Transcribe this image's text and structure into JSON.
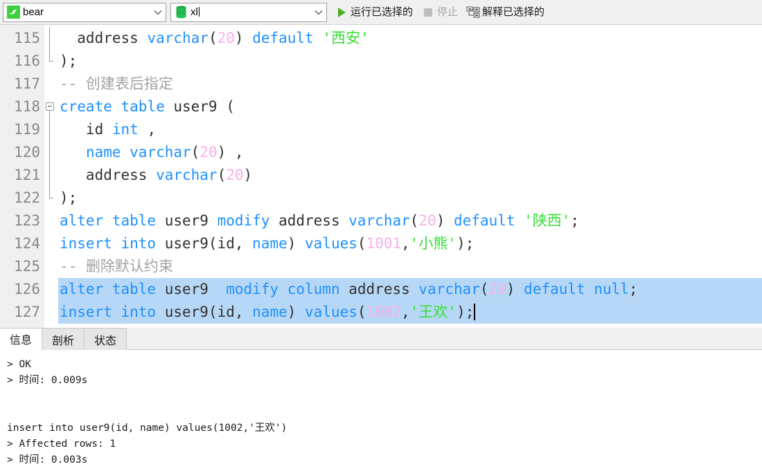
{
  "toolbar": {
    "connection": {
      "icon": "mysql-dolphin-icon",
      "value": "bear",
      "caret": "∨"
    },
    "database": {
      "icon": "database-icon",
      "value": "xl",
      "caret": "∨"
    },
    "run_selected": {
      "icon": "play-icon",
      "label": "运行已选择的"
    },
    "stop": {
      "icon": "stop-icon",
      "label": "停止",
      "disabled": true
    },
    "explain_selected": {
      "icon": "explain-plan-icon",
      "label": "解释已选择的"
    }
  },
  "editor": {
    "first_line_number": 115,
    "lines": [
      {
        "num": 115,
        "selected": false,
        "fold": "mid",
        "tokens": [
          {
            "t": "  address ",
            "c": "plain"
          },
          {
            "t": "varchar",
            "c": "kw"
          },
          {
            "t": "(",
            "c": "plain"
          },
          {
            "t": "20",
            "c": "num"
          },
          {
            "t": ") ",
            "c": "plain"
          },
          {
            "t": "default",
            "c": "kw"
          },
          {
            "t": " ",
            "c": "plain"
          },
          {
            "t": "'西安'",
            "c": "str"
          }
        ]
      },
      {
        "num": 116,
        "selected": false,
        "fold": "end",
        "tokens": [
          {
            "t": ");",
            "c": "plain"
          }
        ]
      },
      {
        "num": 117,
        "selected": false,
        "fold": "none",
        "tokens": [
          {
            "t": "-- 创建表后指定",
            "c": "cmt"
          }
        ]
      },
      {
        "num": 118,
        "selected": false,
        "fold": "start",
        "tokens": [
          {
            "t": "create table",
            "c": "kw"
          },
          {
            "t": " user9 (",
            "c": "plain"
          }
        ]
      },
      {
        "num": 119,
        "selected": false,
        "fold": "mid",
        "tokens": [
          {
            "t": "   id ",
            "c": "plain"
          },
          {
            "t": "int",
            "c": "kw"
          },
          {
            "t": " ,",
            "c": "plain"
          }
        ]
      },
      {
        "num": 120,
        "selected": false,
        "fold": "mid",
        "tokens": [
          {
            "t": "   ",
            "c": "plain"
          },
          {
            "t": "name varchar",
            "c": "kw"
          },
          {
            "t": "(",
            "c": "plain"
          },
          {
            "t": "20",
            "c": "num"
          },
          {
            "t": ") ,",
            "c": "plain"
          }
        ]
      },
      {
        "num": 121,
        "selected": false,
        "fold": "mid",
        "tokens": [
          {
            "t": "   address ",
            "c": "plain"
          },
          {
            "t": "varchar",
            "c": "kw"
          },
          {
            "t": "(",
            "c": "plain"
          },
          {
            "t": "20",
            "c": "num"
          },
          {
            "t": ")",
            "c": "plain"
          }
        ]
      },
      {
        "num": 122,
        "selected": false,
        "fold": "end",
        "tokens": [
          {
            "t": ");",
            "c": "plain"
          }
        ]
      },
      {
        "num": 123,
        "selected": false,
        "fold": "none",
        "tokens": [
          {
            "t": "alter table",
            "c": "kw"
          },
          {
            "t": " user9 ",
            "c": "plain"
          },
          {
            "t": "modify",
            "c": "kw"
          },
          {
            "t": " address ",
            "c": "plain"
          },
          {
            "t": "varchar",
            "c": "kw"
          },
          {
            "t": "(",
            "c": "plain"
          },
          {
            "t": "20",
            "c": "num"
          },
          {
            "t": ") ",
            "c": "plain"
          },
          {
            "t": "default",
            "c": "kw"
          },
          {
            "t": " ",
            "c": "plain"
          },
          {
            "t": "'陕西'",
            "c": "str"
          },
          {
            "t": ";",
            "c": "plain"
          }
        ]
      },
      {
        "num": 124,
        "selected": false,
        "fold": "none",
        "tokens": [
          {
            "t": "insert into",
            "c": "kw"
          },
          {
            "t": " user9(id, ",
            "c": "plain"
          },
          {
            "t": "name",
            "c": "kw"
          },
          {
            "t": ") ",
            "c": "plain"
          },
          {
            "t": "values",
            "c": "kw"
          },
          {
            "t": "(",
            "c": "plain"
          },
          {
            "t": "1001",
            "c": "num"
          },
          {
            "t": ",",
            "c": "plain"
          },
          {
            "t": "'小熊'",
            "c": "str"
          },
          {
            "t": ");",
            "c": "plain"
          }
        ]
      },
      {
        "num": 125,
        "selected": false,
        "fold": "none",
        "tokens": [
          {
            "t": "-- 删除默认约束",
            "c": "cmt"
          }
        ]
      },
      {
        "num": 126,
        "selected": true,
        "fold": "none",
        "tokens": [
          {
            "t": "alter table",
            "c": "kw"
          },
          {
            "t": " user9  ",
            "c": "plain"
          },
          {
            "t": "modify column",
            "c": "kw"
          },
          {
            "t": " address ",
            "c": "plain"
          },
          {
            "t": "varchar",
            "c": "kw"
          },
          {
            "t": "(",
            "c": "plain"
          },
          {
            "t": "20",
            "c": "num"
          },
          {
            "t": ") ",
            "c": "plain"
          },
          {
            "t": "default null",
            "c": "kw"
          },
          {
            "t": ";",
            "c": "plain"
          }
        ]
      },
      {
        "num": 127,
        "selected": true,
        "fold": "none",
        "caret_at_end": true,
        "tokens": [
          {
            "t": "insert into",
            "c": "kw"
          },
          {
            "t": " user9(id, ",
            "c": "plain"
          },
          {
            "t": "name",
            "c": "kw"
          },
          {
            "t": ") ",
            "c": "plain"
          },
          {
            "t": "values",
            "c": "kw"
          },
          {
            "t": "(",
            "c": "plain"
          },
          {
            "t": "1002",
            "c": "num"
          },
          {
            "t": ",",
            "c": "plain"
          },
          {
            "t": "'王欢'",
            "c": "str"
          },
          {
            "t": ");",
            "c": "plain"
          }
        ]
      }
    ]
  },
  "bottom_tabs": [
    {
      "label": "信息",
      "active": true
    },
    {
      "label": "剖析",
      "active": false
    },
    {
      "label": "状态",
      "active": false
    }
  ],
  "output": {
    "lines": [
      "> OK",
      "> 时间: 0.009s",
      "",
      "",
      "insert into user9(id, name) values(1002,'王欢')",
      "> Affected rows: 1",
      "> 时间: 0.003s"
    ]
  },
  "colors": {
    "keyword": "#1e90ff",
    "number": "#f9b0e8",
    "string": "#33e033",
    "comment": "#a3a3a3",
    "selection": "#b6d7f5",
    "gutter_bg": "#f0f0f0",
    "toolbar_bg": "#f0f0f0",
    "run_green": "#4caf27",
    "db_green": "#22b14c"
  }
}
